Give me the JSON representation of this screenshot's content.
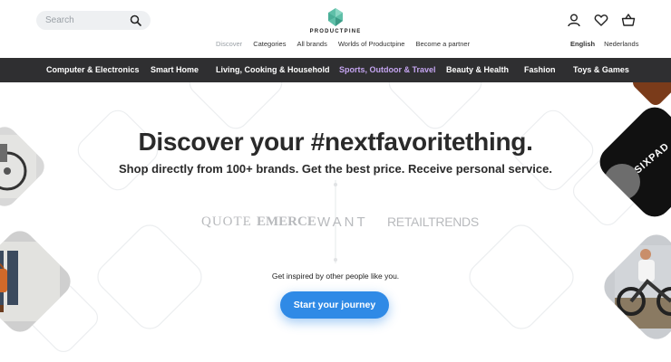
{
  "search": {
    "placeholder": "Search"
  },
  "logo": {
    "text": "PRODUCTPINE"
  },
  "top_nav": [
    {
      "label": "Discover",
      "muted": true
    },
    {
      "label": "Categories"
    },
    {
      "label": "All brands"
    },
    {
      "label": "Worlds of Productpine"
    },
    {
      "label": "Become a partner"
    }
  ],
  "languages": [
    {
      "label": "English",
      "active": true
    },
    {
      "label": "Nederlands"
    }
  ],
  "header_icons": [
    "account-icon",
    "heart-icon",
    "basket-icon"
  ],
  "categories": [
    "Computer & Electronics",
    "Smart Home",
    "Living, Cooking & Household",
    "Sports, Outdoor & Travel",
    "Beauty & Health",
    "Fashion",
    "Toys & Games"
  ],
  "active_category": "Sports, Outdoor & Travel",
  "hero": {
    "headline": "Discover your #nextfavoritething.",
    "subline": "Shop directly from 100+ brands. Get the best price. Receive personal service.",
    "press_logos": [
      "QUOTE",
      "EMERCE",
      "WANT",
      "RETAILTRENDS"
    ],
    "inspire": "Get inspired by other people like you.",
    "cta": "Start your journey",
    "tile_brand": "SIXPAD"
  },
  "colors": {
    "category_bar": "#2f2f31",
    "active_category": "#c4a4f0",
    "cta": "#2f8ae6",
    "logo": "#5fbfa8"
  }
}
